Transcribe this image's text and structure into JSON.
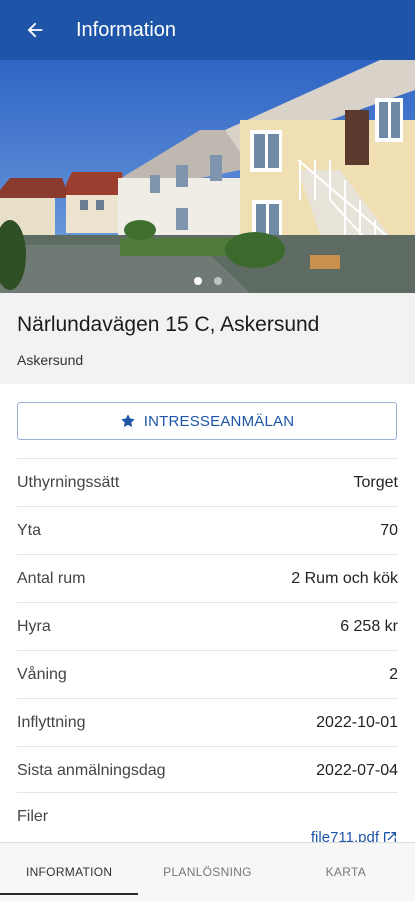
{
  "appbar": {
    "title": "Information",
    "back_icon": "arrow-left-icon"
  },
  "hero": {
    "image": "building-photo",
    "slides": 2,
    "active_slide": 1
  },
  "listing": {
    "address": "Närlundavägen 15 C, Askersund",
    "city": "Askersund"
  },
  "actions": {
    "interest_label": "INTRESSEANMÄLAN",
    "interest_icon": "star-icon"
  },
  "details": [
    {
      "label": "Uthyrningssätt",
      "value": "Torget"
    },
    {
      "label": "Yta",
      "value": "70"
    },
    {
      "label": "Antal rum",
      "value": "2 Rum och kök"
    },
    {
      "label": "Hyra",
      "value": "6 258 kr"
    },
    {
      "label": "Våning",
      "value": "2"
    },
    {
      "label": "Inflyttning",
      "value": "2022-10-01"
    },
    {
      "label": "Sista anmälningsdag",
      "value": "2022-07-04"
    }
  ],
  "files": {
    "label": "Filer",
    "file_name": "file711.pdf",
    "icon": "open-external-icon"
  },
  "tabs": [
    {
      "label": "INFORMATION",
      "active": true
    },
    {
      "label": "PLANLÖSNING",
      "active": false
    },
    {
      "label": "KARTA",
      "active": false
    }
  ],
  "colors": {
    "primary": "#1f55a8",
    "section_bg": "#f2f2f2"
  }
}
